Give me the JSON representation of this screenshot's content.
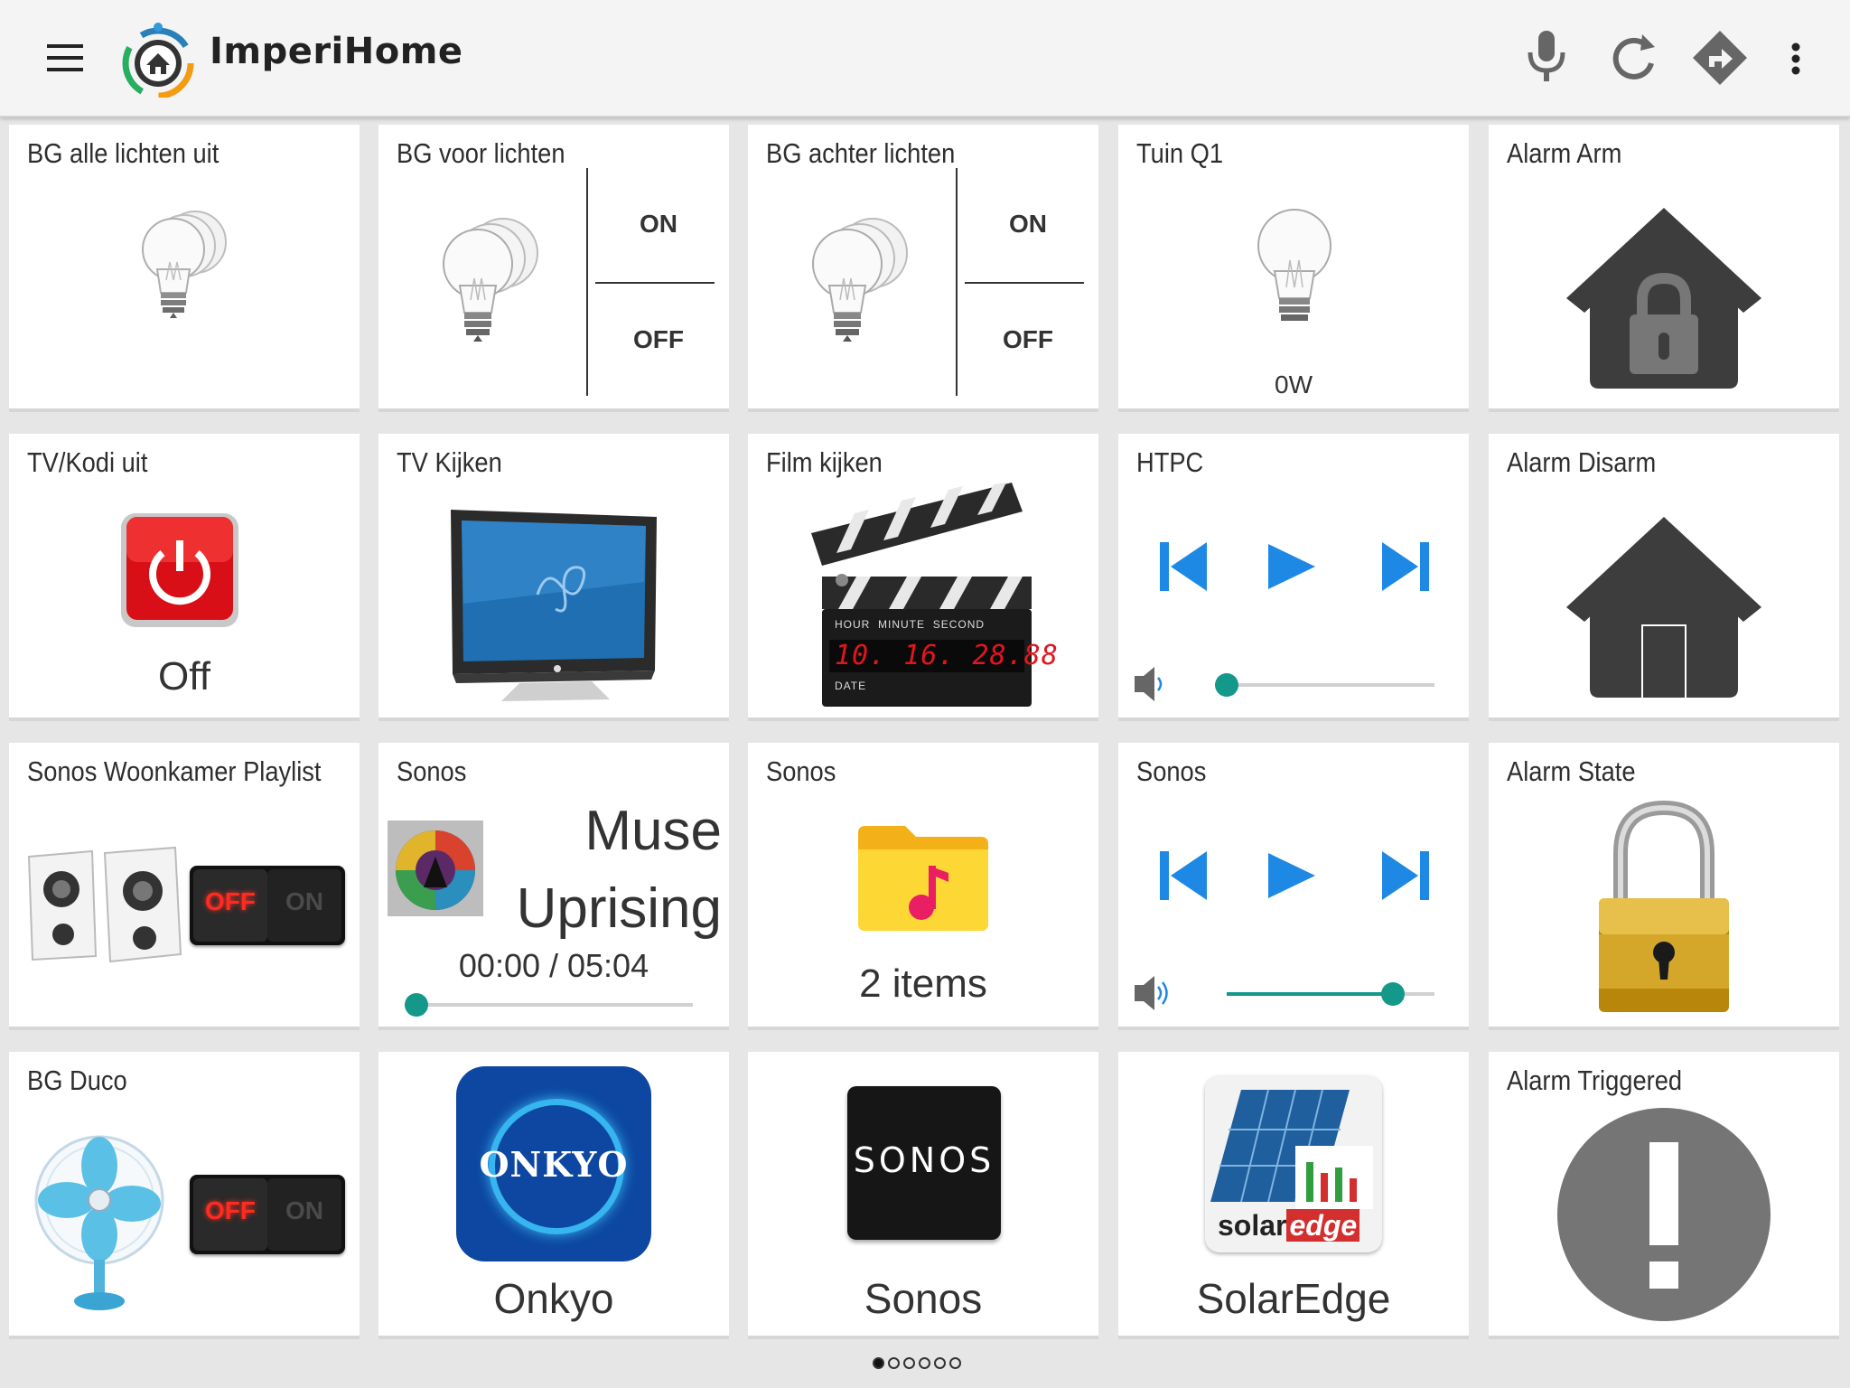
{
  "app": {
    "title": "ImperiHome"
  },
  "toolbar": {
    "icons": [
      "menu-icon",
      "microphone-icon",
      "refresh-icon",
      "directions-icon",
      "more-vert-icon"
    ]
  },
  "tiles": {
    "bg_alle": {
      "name": "BG alle lichten uit"
    },
    "bg_voor": {
      "name": "BG voor lichten",
      "on": "ON",
      "off": "OFF"
    },
    "bg_achter": {
      "name": "BG achter lichten",
      "on": "ON",
      "off": "OFF"
    },
    "tuin": {
      "name": "Tuin Q1",
      "value": "0W"
    },
    "alarm_arm": {
      "name": "Alarm Arm"
    },
    "tv_kodi": {
      "name": "TV/Kodi uit",
      "value": "Off"
    },
    "tv_kijken": {
      "name": "TV Kijken"
    },
    "film": {
      "name": "Film kijken",
      "clock_labels": [
        "HOUR",
        "MINUTE",
        "SECOND"
      ],
      "clock": "10. 16. 28.88",
      "date_label": "DATE"
    },
    "htpc": {
      "name": "HTPC",
      "volume": 0.0
    },
    "alarm_disarm": {
      "name": "Alarm Disarm"
    },
    "sonos_playlist": {
      "name": "Sonos Woonkamer Playlist",
      "switch_off": "OFF",
      "switch_on": "ON"
    },
    "sonos_now": {
      "name": "Sonos",
      "artist": "Muse",
      "album": "Uprising",
      "time": "00:00 / 05:04",
      "progress": 0.0
    },
    "sonos_folder": {
      "name": "Sonos",
      "value": "2 items"
    },
    "sonos_player": {
      "name": "Sonos",
      "volume": 0.8
    },
    "alarm_state": {
      "name": "Alarm State"
    },
    "bg_duco": {
      "name": "BG Duco",
      "switch_off": "OFF",
      "switch_on": "ON"
    },
    "onkyo": {
      "label": "Onkyo",
      "logo_text": "ONKYO"
    },
    "sonos_app": {
      "label": "Sonos",
      "logo_text": "SONOS"
    },
    "solaredge": {
      "label": "SolarEdge",
      "logo_text_a": "solar",
      "logo_text_b": "edge"
    },
    "alarm_triggered": {
      "name": "Alarm Triggered"
    }
  },
  "pager": {
    "count": 6,
    "active": 0
  },
  "colors": {
    "accent": "#13988a",
    "media_blue": "#1e88e5",
    "icon_gray": "#555555",
    "alarm_house": "#3d3d3d"
  }
}
